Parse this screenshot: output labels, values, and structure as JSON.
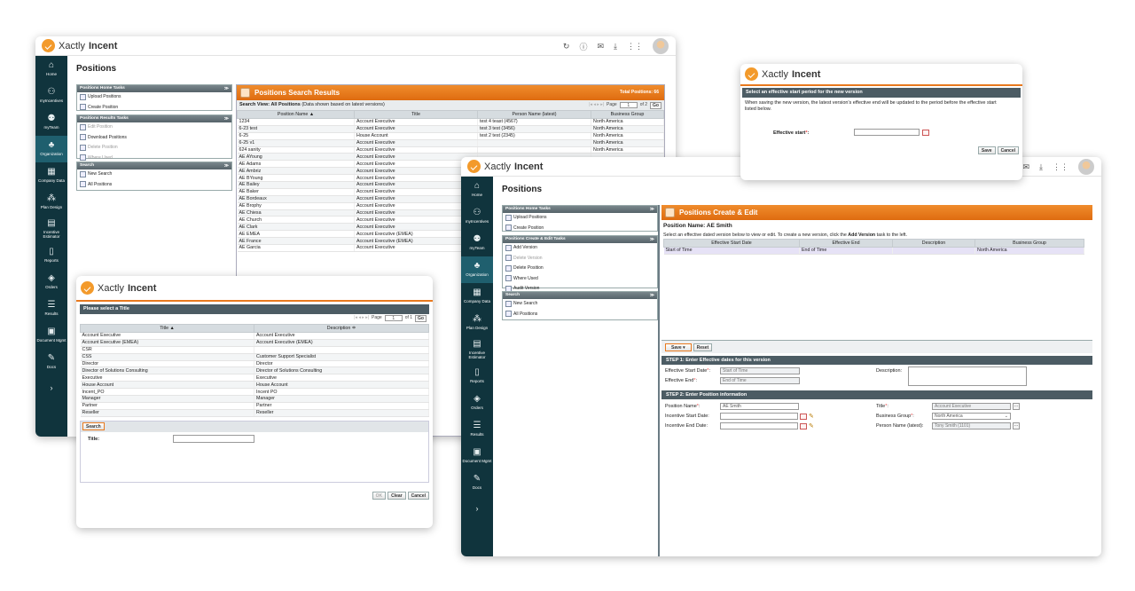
{
  "brand": {
    "name_light": "Xactly",
    "name_bold": "Incent"
  },
  "colors": {
    "sidebar": "#10343d",
    "accent_orange": "#e8791e",
    "header_dark": "#4c5c64"
  },
  "sidebar_items": [
    {
      "label": "Home",
      "icon": "home-icon",
      "glyph": "⌂"
    },
    {
      "label": "myIncentives",
      "icon": "incentives-icon",
      "glyph": "⚇"
    },
    {
      "label": "myTeam",
      "icon": "team-icon",
      "glyph": "⚉"
    },
    {
      "label": "Organization",
      "icon": "organization-icon",
      "glyph": "♣",
      "active": true
    },
    {
      "label": "Company Data",
      "icon": "grid-icon",
      "glyph": "▦"
    },
    {
      "label": "Plan Design",
      "icon": "plan-icon",
      "glyph": "⁂"
    },
    {
      "label": "Incentive Estimator",
      "icon": "estimator-icon",
      "glyph": "▤"
    },
    {
      "label": "Reports",
      "icon": "reports-icon",
      "glyph": "▯"
    },
    {
      "label": "Orders",
      "icon": "layers-icon",
      "glyph": "◈"
    },
    {
      "label": "Results",
      "icon": "results-icon",
      "glyph": "☰"
    },
    {
      "label": "Document Mgmt",
      "icon": "document-icon",
      "glyph": "▣"
    },
    {
      "label": "Docs",
      "icon": "docs-icon",
      "glyph": "✎"
    }
  ],
  "w1": {
    "page_title": "Positions",
    "home_tasks": {
      "header": "Positions Home Tasks",
      "items": [
        "Upload Positions",
        "Create Position"
      ]
    },
    "results_tasks": {
      "header": "Positions Results Tasks",
      "items": [
        "Edit Position",
        "Download Positions",
        "Delete Position",
        "Where Used"
      ]
    },
    "search": {
      "header": "Search",
      "items": [
        "New Search",
        "All Positions"
      ]
    },
    "results": {
      "title": "Positions Search Results",
      "total": "Total Positions: 66",
      "search_view_bold": "Search View: All Positions",
      "search_view_note": "(Data shown based on latest versions)",
      "pager": {
        "page_label": "Page",
        "page": "1",
        "of": "of 2",
        "go": "Go"
      },
      "columns": [
        "Position Name ▲",
        "Title",
        "Person Name (latest)",
        "Business Group"
      ],
      "rows": [
        [
          "1234",
          "Account Executive",
          "test 4 teast (4567)",
          "North America"
        ],
        [
          "6-23 test",
          "Account Executive",
          "test 3 test (3456)",
          "North America"
        ],
        [
          "6-25",
          "House Account",
          "test 2 test (2345)",
          "North America"
        ],
        [
          "6-25 v1",
          "Account Executive",
          "",
          "North America"
        ],
        [
          "624 sanity",
          "Account Executive",
          "",
          "North America"
        ],
        [
          "AE AYoung",
          "Account Executive",
          "",
          ""
        ],
        [
          "AE Adams",
          "Account Executive",
          "",
          ""
        ],
        [
          "AE Ambriz",
          "Account Executive",
          "",
          ""
        ],
        [
          "AE BYoung",
          "Account Executive",
          "",
          ""
        ],
        [
          "AE Bailey",
          "Account Executive",
          "",
          ""
        ],
        [
          "AE Baker",
          "Account Executive",
          "",
          ""
        ],
        [
          "AE Bordeaux",
          "Account Executive",
          "",
          ""
        ],
        [
          "AE Brophy",
          "Account Executive",
          "",
          ""
        ],
        [
          "AE Chiesa",
          "Account Executive",
          "",
          ""
        ],
        [
          "AE Church",
          "Account Executive",
          "",
          ""
        ],
        [
          "AE Clark",
          "Account Executive",
          "",
          ""
        ],
        [
          "AE EMEA",
          "Account Executive (EMEA)",
          "",
          ""
        ],
        [
          "AE France",
          "Account Executive (EMEA)",
          "",
          ""
        ],
        [
          "AE Garcia",
          "Account Executive",
          "",
          ""
        ]
      ]
    }
  },
  "w2": {
    "header": "Please select a Title",
    "pager": {
      "page_label": "Page",
      "page": "1",
      "of": "of 1",
      "go": "Go"
    },
    "columns": [
      "Title ▲",
      "Description ≑"
    ],
    "rows": [
      [
        "Account Executive",
        "Account Executive"
      ],
      [
        "Account Executive (EMEA)",
        "Account Executive (EMEA)"
      ],
      [
        "CSR",
        ""
      ],
      [
        "CSS",
        "Customer Support Specialist"
      ],
      [
        "Director",
        "Director"
      ],
      [
        "Director of Solutions Consulting",
        "Director of Solutions Consulting"
      ],
      [
        "Executive",
        "Executive"
      ],
      [
        "House Account",
        "House Account"
      ],
      [
        "Incent_PO",
        "Incent PO"
      ],
      [
        "Manager",
        "Manager"
      ],
      [
        "Partner",
        "Partner"
      ],
      [
        "Reseller",
        "Reseller"
      ]
    ],
    "search_tab": "Search",
    "title_label": "Title:",
    "title_value": "",
    "buttons": {
      "ok": "OK",
      "clear": "Clear",
      "cancel": "Cancel"
    }
  },
  "w3": {
    "header": "Select an effective start period for the new version",
    "message": "When saving the new version, the latest version's effective end will be updated to the period before the effective start listed below.",
    "label": "Effective start",
    "value": "",
    "buttons": {
      "save": "Save",
      "cancel": "Cancel"
    }
  },
  "w4": {
    "page_title": "Positions",
    "home_tasks": {
      "header": "Positions Home Tasks",
      "items": [
        "Upload Positions",
        "Create Position"
      ]
    },
    "edit_tasks": {
      "header": "Positions Create & Edit Tasks",
      "items": [
        "Add Version",
        "Delete Version",
        "Delete Position",
        "Where Used",
        "Audit Version"
      ]
    },
    "search": {
      "header": "Search",
      "items": [
        "New Search",
        "All Positions"
      ]
    },
    "panel_title": "Positions Create & Edit",
    "position_name_heading": "Position Name: AE Smith",
    "instruction_pre": "Select an effective dated version below to view or edit. To create a new version, click the ",
    "instruction_bold": "Add Version",
    "instruction_post": " task to the left.",
    "version_columns": [
      "Effective Start Date",
      "Effective End",
      "Description",
      "Business Group"
    ],
    "version_row": [
      "Start of Time",
      "End of Time",
      "",
      "North America"
    ],
    "save_label": "Save ▾",
    "reset_label": "Reset",
    "step1": "STEP 1: Enter Effective dates for this version",
    "eff_start_label": "Effective Start Date",
    "eff_start_value": "Start of Time",
    "eff_end_label": "Effective End",
    "eff_end_value": "End of Time",
    "description_label": "Description:",
    "step2": "STEP 2: Enter Position information",
    "position_name_label": "Position Name",
    "position_name_value": "AE Smith",
    "inc_start_label": "Incentive Start Date:",
    "inc_end_label": "Incentive End Date:",
    "title_label": "Title",
    "title_value": "Account Executive",
    "bg_label": "Business Group",
    "bg_value": "North America",
    "person_label": "Person Name (latest):",
    "person_value": "Tony Smith (1101)"
  }
}
